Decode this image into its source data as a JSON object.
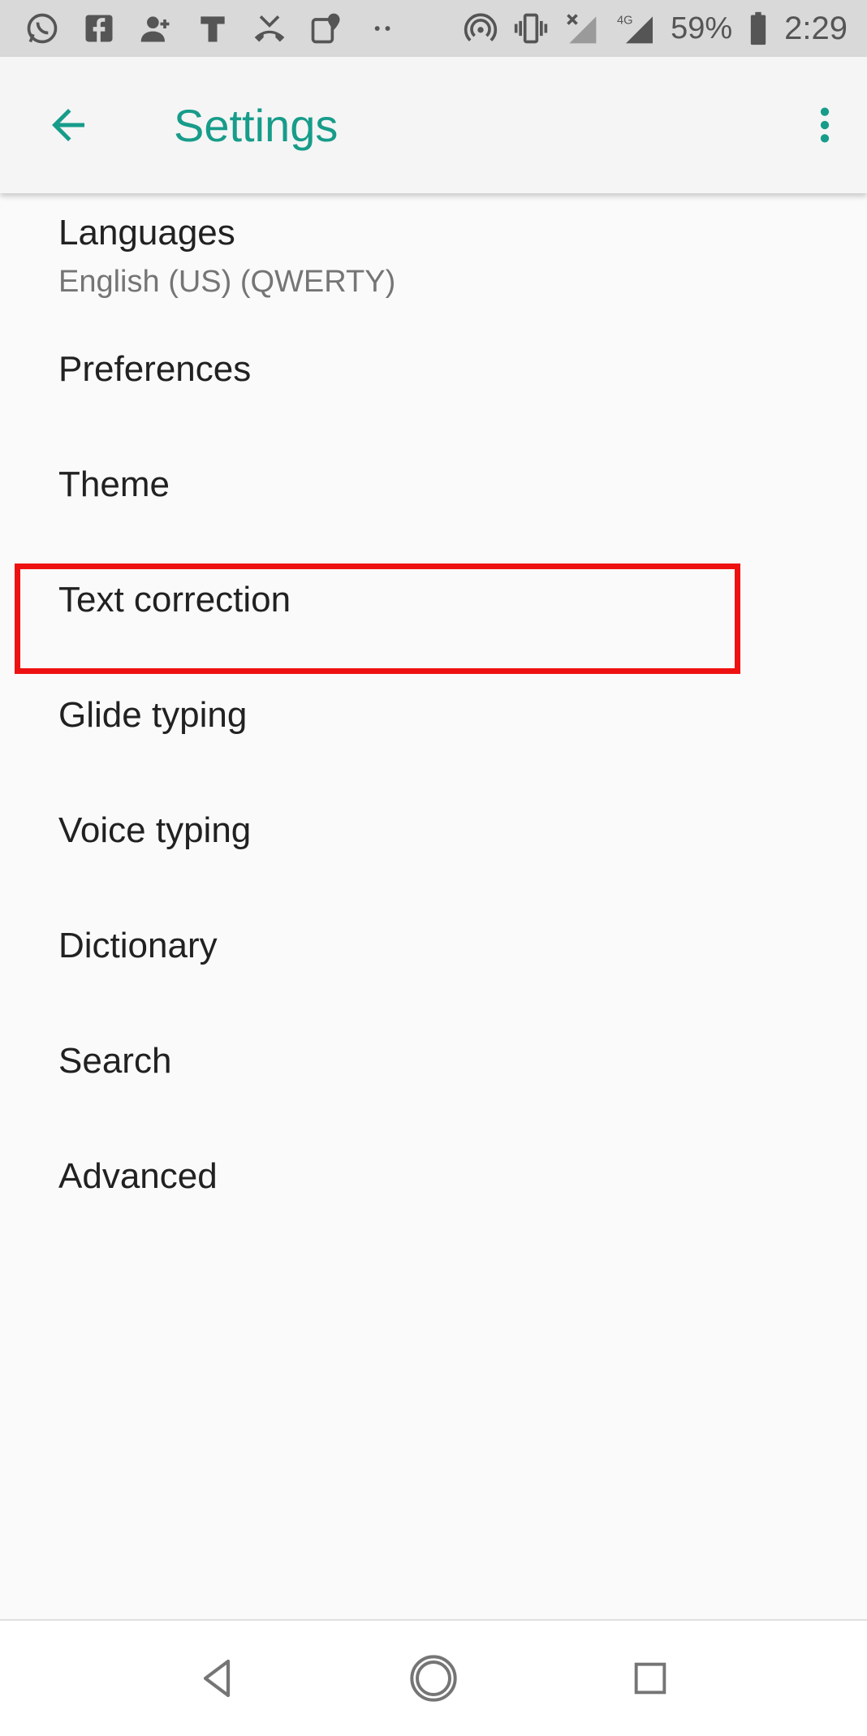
{
  "status_bar": {
    "left_icons": [
      "whatsapp-icon",
      "facebook-icon",
      "add-contact-icon",
      "t-app-icon",
      "missed-call-icon",
      "maps-icon",
      "more-dots-icon"
    ],
    "right_icons": [
      "hotspot-icon",
      "vibrate-icon",
      "no-signal-icon",
      "network-type-icon",
      "signal-icon",
      "battery-icon"
    ],
    "network_type": "4G",
    "battery_percent": "59%",
    "time": "2:29"
  },
  "app_bar": {
    "title": "Settings"
  },
  "settings_list": [
    {
      "label": "Languages",
      "sublabel": "English (US) (QWERTY)"
    },
    {
      "label": "Preferences"
    },
    {
      "label": "Theme"
    },
    {
      "label": "Text correction"
    },
    {
      "label": "Glide typing"
    },
    {
      "label": "Voice typing"
    },
    {
      "label": "Dictionary"
    },
    {
      "label": "Search"
    },
    {
      "label": "Advanced"
    }
  ],
  "colors": {
    "accent": "#179c8a",
    "highlight_border": "#ee1111",
    "status_bar_bg": "#d9d9d9",
    "page_bg": "#fafafa"
  }
}
